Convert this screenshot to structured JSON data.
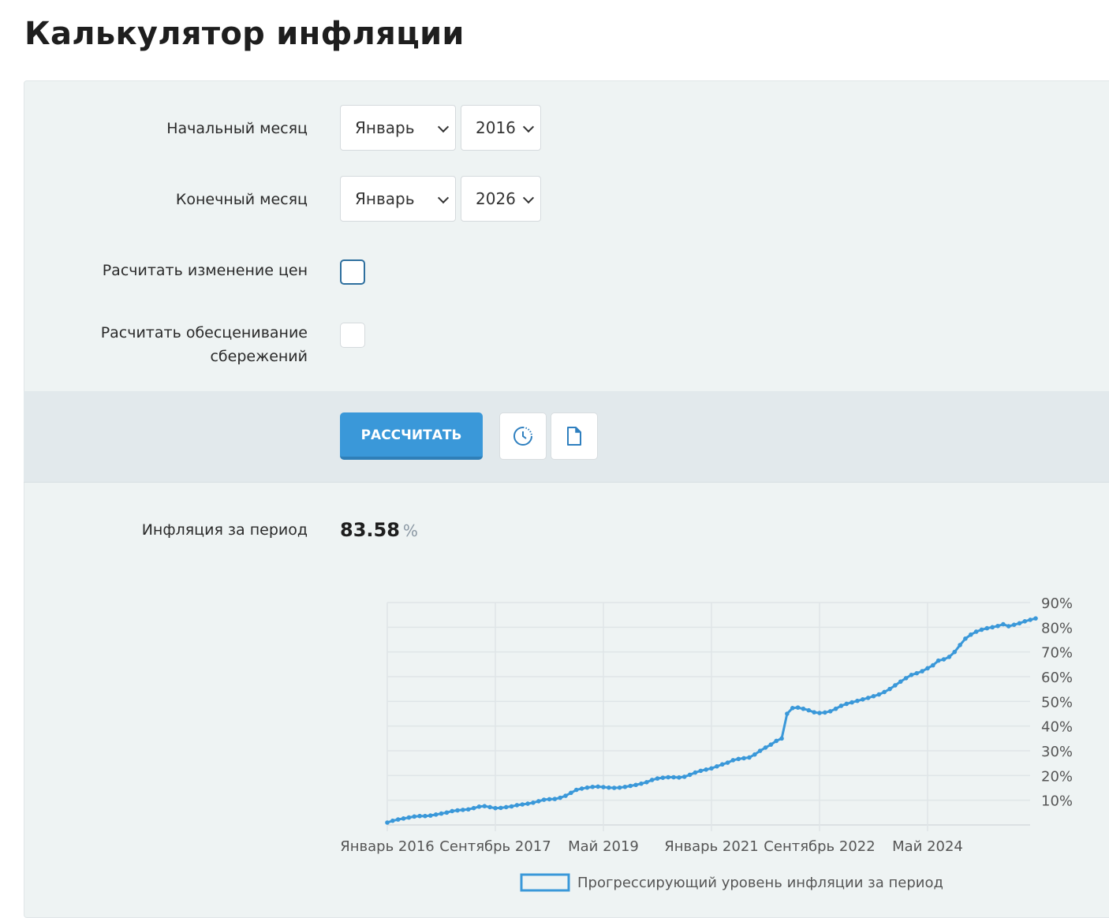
{
  "title": "Калькулятор инфляции",
  "form": {
    "start_label": "Начальный месяц",
    "start_month": "Январь",
    "start_year": "2016",
    "end_label": "Конечный месяц",
    "end_month": "Январь",
    "end_year": "2026",
    "price_change_label": "Расчитать изменение цен",
    "savings_label_line1": "Расчитать обесценивание",
    "savings_label_line2": "сбережений"
  },
  "actions": {
    "calculate_label": "РАССЧИТАТЬ",
    "history_icon": "history-clock-icon",
    "document_icon": "document-icon"
  },
  "result": {
    "label": "Инфляция за период",
    "value": "83.58",
    "unit": "%"
  },
  "chart_data": {
    "type": "line",
    "title": "",
    "series_color": "#3a98d9",
    "legend": "Прогрессирующий уровень инфляции за период",
    "legend_position": "bottom",
    "x_tick_labels": [
      "Январь 2016",
      "Сентябрь 2017",
      "Май 2019",
      "Январь 2021",
      "Сентябрь 2022",
      "Май 2024"
    ],
    "x_tick_month_index": [
      0,
      20,
      40,
      60,
      80,
      100
    ],
    "y_tick_labels": [
      "10%",
      "20%",
      "30%",
      "40%",
      "50%",
      "60%",
      "70%",
      "80%",
      "90%"
    ],
    "y_ticks": [
      10,
      20,
      30,
      40,
      50,
      60,
      70,
      80,
      90
    ],
    "ylim": [
      0,
      90
    ],
    "x_start": "Январь 2016",
    "x_end": "Январь 2026",
    "grid": true,
    "values": [
      0.96,
      1.7,
      2.2,
      2.6,
      3.0,
      3.4,
      3.6,
      3.6,
      3.8,
      4.2,
      4.6,
      5.0,
      5.6,
      5.9,
      6.1,
      6.3,
      6.8,
      7.4,
      7.6,
      7.2,
      6.8,
      6.9,
      7.2,
      7.5,
      8.0,
      8.3,
      8.6,
      9.0,
      9.6,
      10.2,
      10.4,
      10.5,
      11.0,
      11.8,
      13.0,
      14.2,
      14.7,
      15.1,
      15.4,
      15.5,
      15.3,
      15.1,
      15.0,
      15.1,
      15.4,
      15.8,
      16.2,
      16.7,
      17.3,
      18.2,
      18.8,
      19.1,
      19.3,
      19.3,
      19.2,
      19.5,
      20.3,
      21.2,
      21.9,
      22.4,
      22.9,
      23.7,
      24.5,
      25.2,
      26.2,
      26.7,
      27.0,
      27.3,
      28.5,
      30.0,
      31.3,
      32.5,
      34.0,
      35.0,
      45.0,
      47.3,
      47.5,
      47.0,
      46.4,
      45.6,
      45.3,
      45.5,
      46.0,
      47.0,
      48.2,
      49.0,
      49.6,
      50.2,
      50.8,
      51.4,
      52.1,
      52.8,
      53.8,
      55.0,
      56.5,
      58.0,
      59.4,
      60.7,
      61.4,
      62.2,
      63.4,
      64.6,
      66.5,
      67.0,
      68.0,
      70.0,
      72.8,
      75.4,
      77.0,
      78.2,
      79.0,
      79.6,
      80.0,
      80.5,
      81.2,
      80.4,
      81.0,
      81.6,
      82.4,
      83.0,
      83.58
    ]
  }
}
